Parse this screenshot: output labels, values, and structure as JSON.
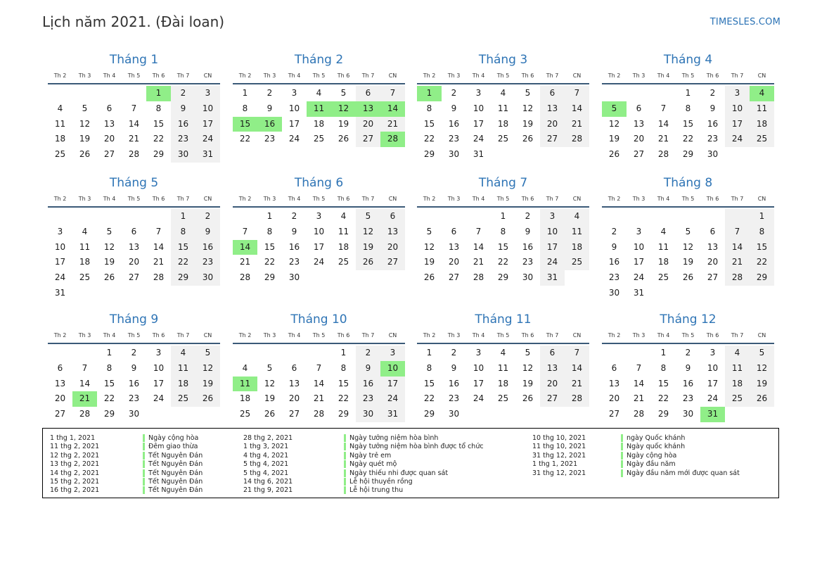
{
  "header": {
    "title": "Lịch năm 2021. (Đài loan)",
    "site": "TIMESLES.COM"
  },
  "weekdays": [
    "Th 2",
    "Th 3",
    "Th 4",
    "Th 5",
    "Th 6",
    "Th 7",
    "CN"
  ],
  "colors": {
    "accent": "#2e74b5",
    "holiday": "#90ee88",
    "weekend": "#f1f1f1"
  },
  "months": [
    {
      "name": "Tháng 1",
      "offset": 4,
      "days": 31,
      "holidays": [
        1
      ]
    },
    {
      "name": "Tháng 2",
      "offset": 0,
      "days": 28,
      "holidays": [
        11,
        12,
        13,
        14,
        15,
        16,
        28
      ]
    },
    {
      "name": "Tháng 3",
      "offset": 0,
      "days": 31,
      "holidays": [
        1
      ]
    },
    {
      "name": "Tháng 4",
      "offset": 3,
      "days": 30,
      "holidays": [
        4,
        5
      ]
    },
    {
      "name": "Tháng 5",
      "offset": 5,
      "days": 31,
      "holidays": []
    },
    {
      "name": "Tháng 6",
      "offset": 1,
      "days": 30,
      "holidays": [
        14
      ]
    },
    {
      "name": "Tháng 7",
      "offset": 3,
      "days": 31,
      "holidays": []
    },
    {
      "name": "Tháng 8",
      "offset": 6,
      "days": 31,
      "holidays": []
    },
    {
      "name": "Tháng 9",
      "offset": 2,
      "days": 30,
      "holidays": [
        21
      ]
    },
    {
      "name": "Tháng 10",
      "offset": 4,
      "days": 31,
      "holidays": [
        10,
        11
      ]
    },
    {
      "name": "Tháng 11",
      "offset": 0,
      "days": 30,
      "holidays": []
    },
    {
      "name": "Tháng 12",
      "offset": 2,
      "days": 31,
      "holidays": [
        31
      ]
    }
  ],
  "legend": [
    [
      {
        "date": "1 thg 1, 2021",
        "name": "Ngày cộng hòa"
      },
      {
        "date": "11 thg 2, 2021",
        "name": "Đêm giao thừa"
      },
      {
        "date": "12 thg 2, 2021",
        "name": "Tết Nguyên Đán"
      },
      {
        "date": "13 thg 2, 2021",
        "name": "Tết Nguyên Đán"
      },
      {
        "date": "14 thg 2, 2021",
        "name": "Tết Nguyên Đán"
      },
      {
        "date": "15 thg 2, 2021",
        "name": "Tết Nguyên Đán"
      },
      {
        "date": "16 thg 2, 2021",
        "name": "Tết Nguyên Đán"
      }
    ],
    [
      {
        "date": "28 thg 2, 2021",
        "name": "Ngày tưởng niệm hòa bình"
      },
      {
        "date": "1 thg 3, 2021",
        "name": "Ngày tưởng niệm hòa bình được tổ chức"
      },
      {
        "date": "4 thg 4, 2021",
        "name": "Ngày trẻ em"
      },
      {
        "date": "5 thg 4, 2021",
        "name": "Ngày quét mộ"
      },
      {
        "date": "5 thg 4, 2021",
        "name": "Ngày thiếu nhi được quan sát"
      },
      {
        "date": "14 thg 6, 2021",
        "name": "Lễ hội thuyền rồng"
      },
      {
        "date": "21 thg 9, 2021",
        "name": "Lễ hội trung thu"
      }
    ],
    [
      {
        "date": "10 thg 10, 2021",
        "name": "ngày Quốc khánh"
      },
      {
        "date": "11 thg 10, 2021",
        "name": "Ngày quốc khánh"
      },
      {
        "date": "31 thg 12, 2021",
        "name": "Ngày cộng hòa"
      },
      {
        "date": "1 thg 1, 2021",
        "name": "Ngày đầu năm"
      },
      {
        "date": "31 thg 12, 2021",
        "name": "Ngày đầu năm mới được quan sát"
      }
    ]
  ]
}
